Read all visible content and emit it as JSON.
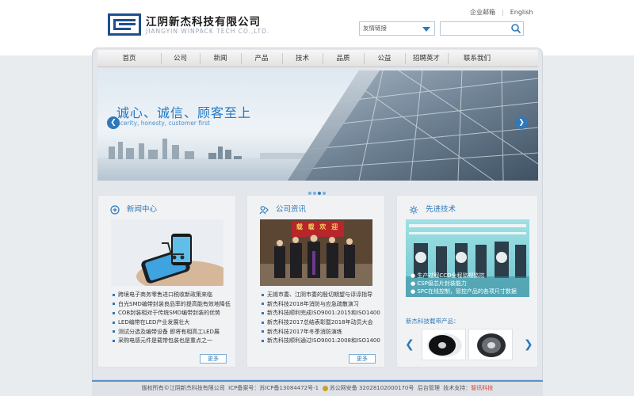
{
  "header": {
    "company_cn": "江阴新杰科技有限公司",
    "company_en": "JIANGYIN WINPACK TECH CO.,LTD.",
    "links": [
      "企业邮箱",
      "English"
    ],
    "link_separator": "|",
    "friendly_links": "友情链接",
    "search_placeholder": ""
  },
  "nav": [
    "首页",
    "公司",
    "新闻",
    "产品",
    "技术",
    "品质",
    "公益",
    "招聘英才",
    "联系我们"
  ],
  "hero": {
    "title": "诚心、诚信、顾客至上",
    "subtitle": "ncerity, honesty, customer first",
    "slide_count": 4,
    "active_slide": 2
  },
  "news": {
    "title": "新闻中心",
    "items": [
      "跨境电子商务零售进口税收新政策来临",
      "白光SMD编带封装良品率的提高能有效地降低",
      "COB封装相对于传统SMD编带封装的优势",
      "LED编带在LED产业发展壮大",
      "测试分选及编带设备 即将有相高工LED展",
      "采购电感元件是载带包装也是重点之一"
    ],
    "more": "更多"
  },
  "company": {
    "title": "公司资讯",
    "banner_text": "载 载 欢 迎",
    "items": [
      "无锡市委、江阴市委的殷切期望与谆谆指导",
      "新杰科技2018年消防与应急疏散演习",
      "新杰科技顺利完成ISO9001:2015和ISO14001:2",
      "新杰科技2017总结表彰暨2018年动员大会",
      "新杰科技2017年冬季消防演练",
      "新杰科技顺利通过ISO9001:2008和ISO14001:2"
    ],
    "more": "更多"
  },
  "tech": {
    "title": "先进技术",
    "bullets": [
      "生产过程CCD全程监视监控",
      "CSP级芯片封装能力",
      "SPC在线控制，管控产品的各项尺寸数据"
    ],
    "products_title": "新杰科技载带产品：",
    "products": [
      "reel-white",
      "reel-dark"
    ]
  },
  "footer": {
    "copyright": "版权所有©江阴新杰科技有限公司",
    "icp": "ICP备案号：苏ICP备13084472号-1",
    "police": "苏公网安备 32028102000170号",
    "admin": "后台管理",
    "support_label": "技术支持：",
    "support_name": "智讯科技"
  },
  "colors": {
    "accent": "#2f79b9",
    "logo": "#1d4f91",
    "footer_border": "#5b93c9",
    "support_red": "#d43b2f"
  },
  "icons": [
    "search-icon",
    "dropdown-arrow-icon",
    "news-icon",
    "company-icon",
    "tech-icon",
    "prev-arrow-icon",
    "next-arrow-icon"
  ]
}
